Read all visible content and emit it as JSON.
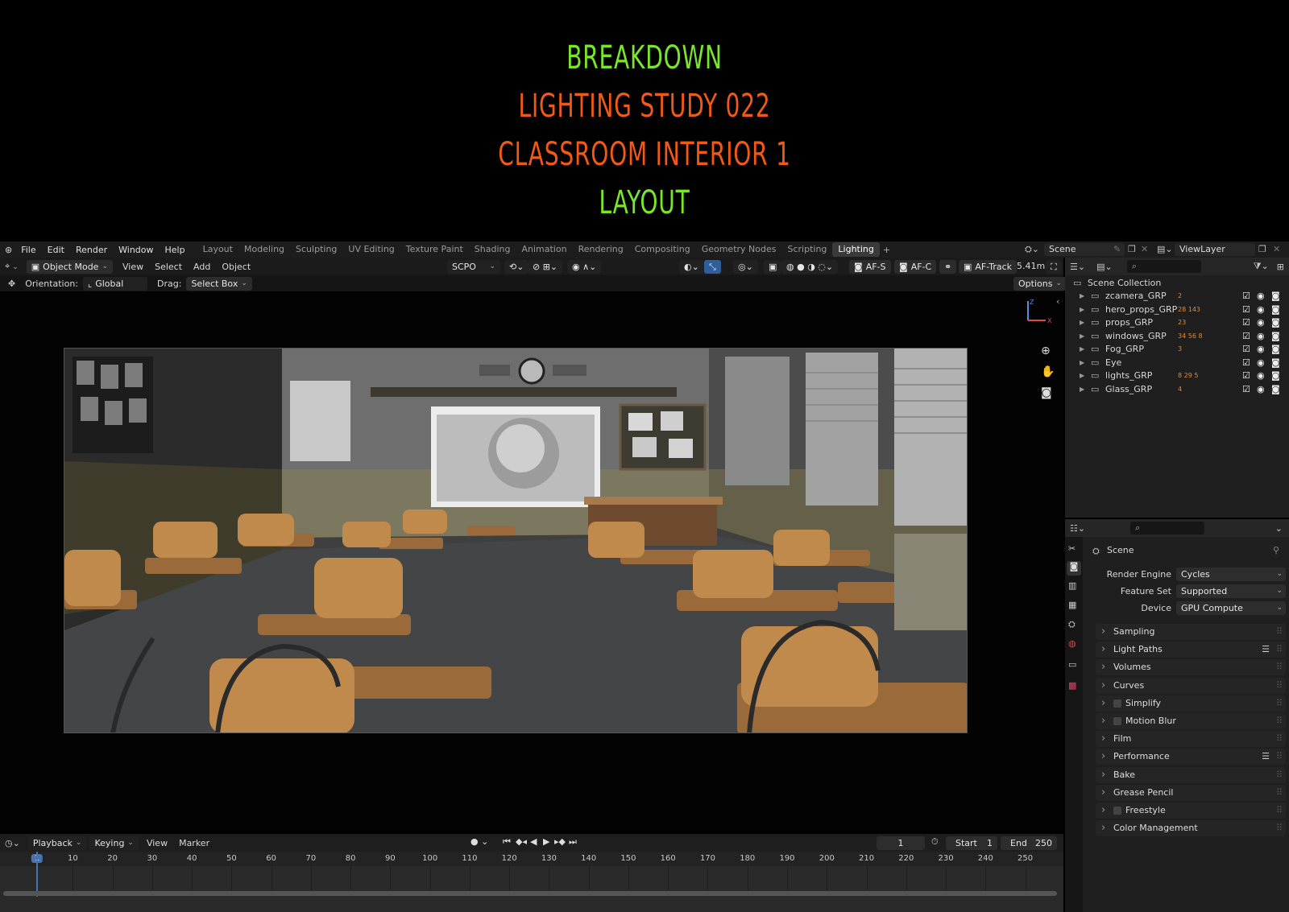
{
  "titles": {
    "line1": "BREAKDOWN",
    "line2": "LIGHTING  STUDY  022",
    "line3": "CLASSROOM INTERIOR 1",
    "line4": "LAYOUT"
  },
  "menu": [
    "File",
    "Edit",
    "Render",
    "Window",
    "Help"
  ],
  "workspaces": [
    "Layout",
    "Modeling",
    "Sculpting",
    "UV Editing",
    "Texture Paint",
    "Shading",
    "Animation",
    "Rendering",
    "Compositing",
    "Geometry Nodes",
    "Scripting",
    "Lighting"
  ],
  "active_workspace": "Lighting",
  "scene_name": "Scene",
  "view_layer": "ViewLayer",
  "viewport_header": {
    "mode": "Object Mode",
    "menus": [
      "View",
      "Select",
      "Add",
      "Object"
    ],
    "transform_orientation": "SCPO",
    "af_buttons": [
      "AF-S",
      "AF-C",
      "AF-Track"
    ],
    "distance": "5.41m"
  },
  "toolset": {
    "orientation_label": "Orientation:",
    "orientation_value": "Global",
    "drag_label": "Drag:",
    "drag_value": "Select Box",
    "options": "Options"
  },
  "outliner": {
    "root": "Scene Collection",
    "items": [
      {
        "name": "zcamera_GRP",
        "badge": "2"
      },
      {
        "name": "hero_props_GRP",
        "badge": "28 143"
      },
      {
        "name": "props_GRP",
        "badge": "23"
      },
      {
        "name": "windows_GRP",
        "badge": "34 56 8"
      },
      {
        "name": "Fog_GRP",
        "badge": "3"
      },
      {
        "name": "Eye",
        "badge": ""
      },
      {
        "name": "lights_GRP",
        "badge": "8 29 5"
      },
      {
        "name": "Glass_GRP",
        "badge": "4"
      }
    ]
  },
  "properties": {
    "context": "Scene",
    "render_engine_label": "Render Engine",
    "render_engine": "Cycles",
    "feature_set_label": "Feature Set",
    "feature_set": "Supported",
    "device_label": "Device",
    "device": "GPU Compute",
    "panels": [
      "Sampling",
      "Light Paths",
      "Volumes",
      "Curves",
      "Simplify",
      "Motion Blur",
      "Film",
      "Performance",
      "Bake",
      "Grease Pencil",
      "Freestyle",
      "Color Management"
    ]
  },
  "timeline": {
    "menus": [
      "Playback",
      "Keying",
      "View",
      "Marker"
    ],
    "current_frame": "1",
    "start_label": "Start",
    "start": "1",
    "end_label": "End",
    "end": "250",
    "ticks": [
      "1",
      "10",
      "20",
      "30",
      "40",
      "50",
      "60",
      "70",
      "80",
      "90",
      "100",
      "110",
      "120",
      "130",
      "140",
      "150",
      "160",
      "170",
      "180",
      "190",
      "200",
      "210",
      "220",
      "230",
      "240",
      "250"
    ]
  },
  "colors": {
    "title_green": "#7ae62b",
    "title_orange": "#f15a16",
    "accent_blue": "#4772b3",
    "ui_bg": "#1f1f1f"
  }
}
